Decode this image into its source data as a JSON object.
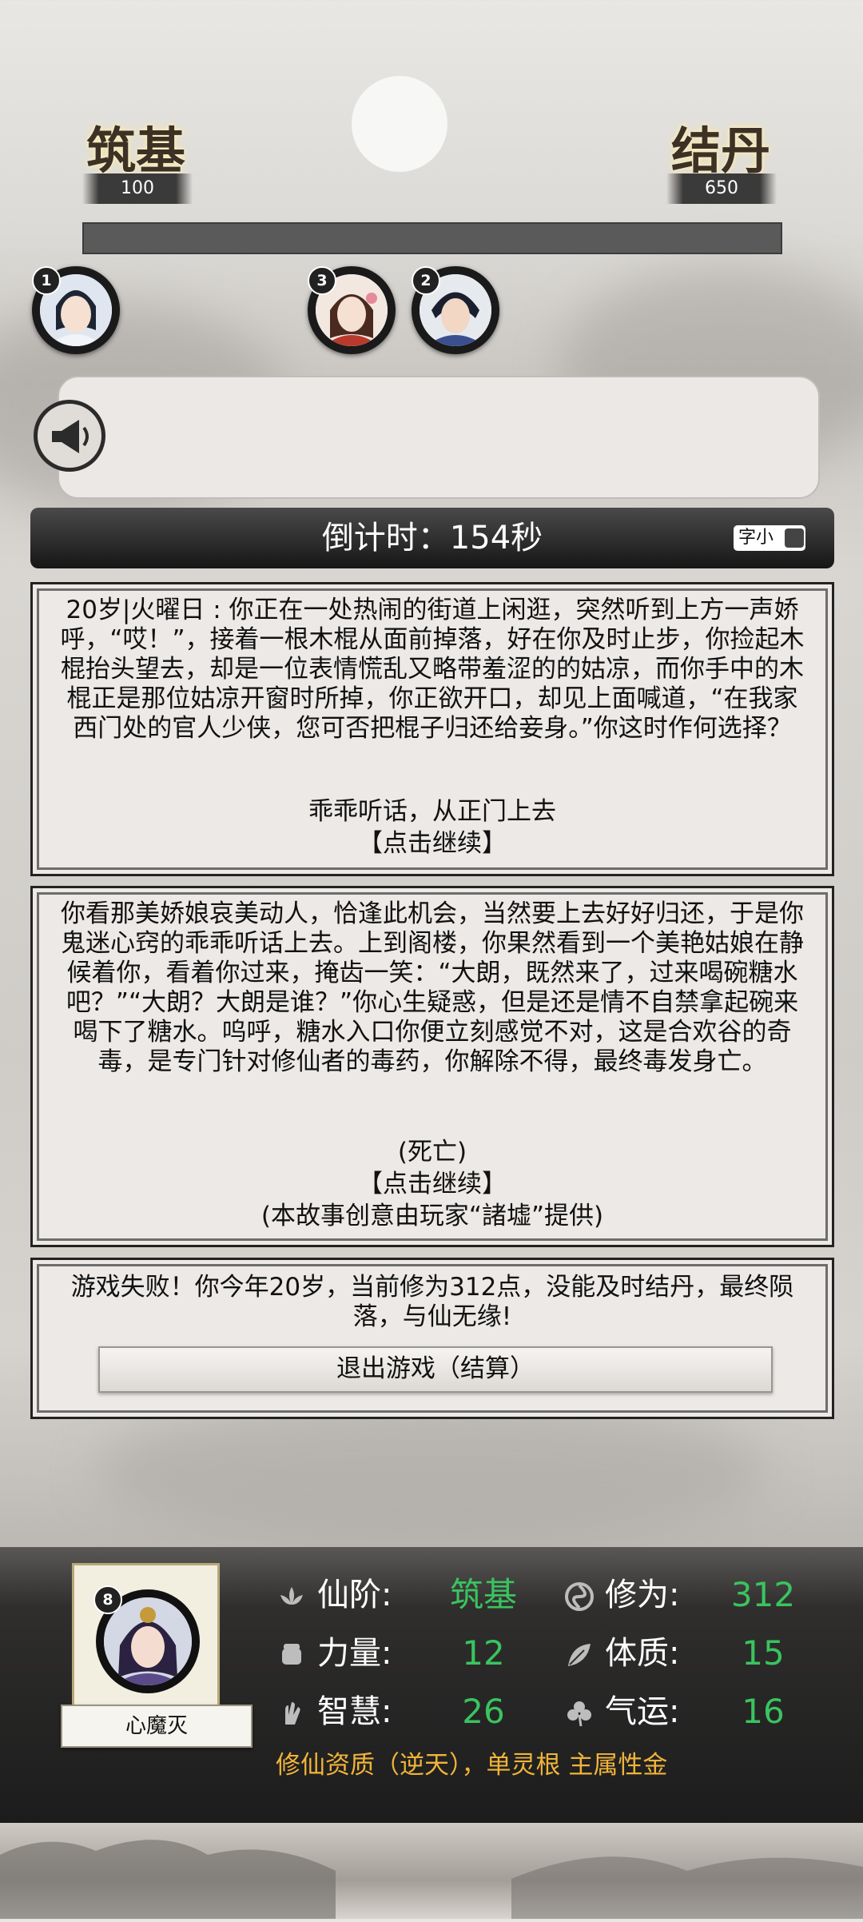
{
  "header": {
    "current_realm": {
      "name": "筑基",
      "value": "100"
    },
    "next_realm": {
      "name": "结丹",
      "value": "650"
    },
    "progress_fraction": 0.0
  },
  "players": [
    {
      "rank": "1"
    },
    {
      "rank": "3"
    },
    {
      "rank": "2"
    }
  ],
  "countdown": {
    "label": "倒计时：154秒",
    "font_toggle": "字小"
  },
  "story": {
    "event_text": "20岁|火曜日 : 你正在一处热闹的街道上闲逛，突然听到上方一声娇呼，“哎！”，接着一根木棍从面前掉落，好在你及时止步，你捡起木棍抬头望去，却是一位表情慌乱又略带羞涩的的姑凉，而你手中的木棍正是那位姑凉开窗时所掉，你正欲开口，却见上面喊道，“在我家西门处的官人少侠，您可否把棍子归还给妾身。”你这时作何选择？",
    "choice": "乖乖听话，从正门上去",
    "continue_1": "【点击继续】",
    "result_text": "你看那美娇娘哀美动人，恰逢此机会，当然要上去好好归还，于是你鬼迷心窍的乖乖听话上去。上到阁楼，你果然看到一个美艳姑娘在静候着你，看着你过来，掩齿一笑：“大朗，既然来了，过来喝碗糖水吧？”“大朗？大朗是谁？”你心生疑惑，但是还是情不自禁拿起碗来喝下了糖水。呜呼，糖水入口你便立刻感觉不对，这是合欢谷的奇毒，是专门针对修仙者的毒药，你解除不得，最终毒发身亡。",
    "death_note": "(死亡)",
    "continue_2": "【点击继续】",
    "credit": "(本故事创意由玩家“諸墟”提供)"
  },
  "game_over": {
    "text": "游戏失败！你今年20岁，当前修为312点，没能及时结丹，最终陨落，与仙无缘!",
    "exit_button": "退出游戏（结算）"
  },
  "character": {
    "rank": "8",
    "name": "心魔灭",
    "stats": {
      "realm_label": "仙阶:",
      "realm_value": "筑基",
      "cultivation_label": "修为:",
      "cultivation_value": "312",
      "strength_label": "力量:",
      "strength_value": "12",
      "constitution_label": "体质:",
      "constitution_value": "15",
      "wisdom_label": "智慧:",
      "wisdom_value": "26",
      "luck_label": "气运:",
      "luck_value": "16"
    },
    "aptitude": "修仙资质（逆天），单灵根 主属性金"
  },
  "colors": {
    "accent_green": "#39c45f",
    "choice_orange": "#f39b2b",
    "aptitude_gold": "#f0b43a"
  }
}
